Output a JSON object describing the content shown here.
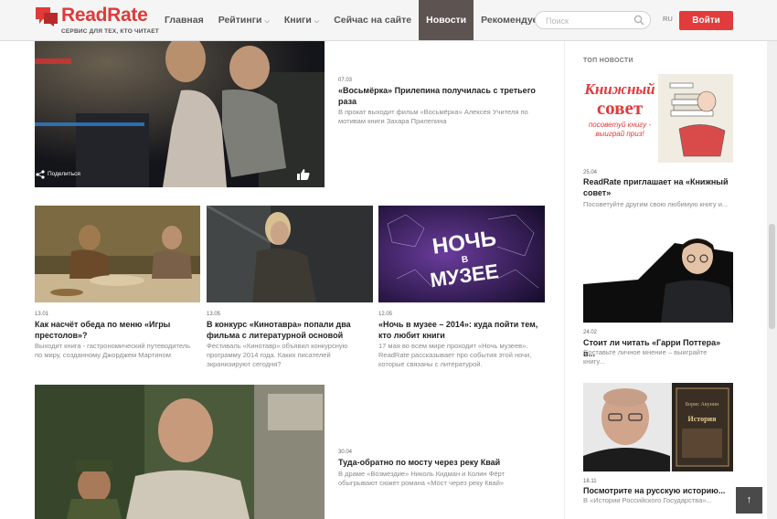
{
  "header": {
    "logo_text": "ReadRate",
    "tagline": "СЕРВИС ДЛЯ ТЕХ, КТО ЧИТАЕТ",
    "nav": [
      {
        "label": "Главная",
        "caret": false,
        "active": false
      },
      {
        "label": "Рейтинги",
        "caret": true,
        "active": false
      },
      {
        "label": "Книги",
        "caret": true,
        "active": false
      },
      {
        "label": "Сейчас на сайте",
        "caret": false,
        "active": false
      },
      {
        "label": "Новости",
        "caret": false,
        "active": true
      },
      {
        "label": "Рекомендуем",
        "caret": false,
        "active": false
      }
    ],
    "search_placeholder": "Поиск",
    "lang": "RU",
    "login_label": "Войти"
  },
  "feature": {
    "date": "07.03",
    "title": "«Восьмёрка» Прилепина получилась с третьего раза",
    "desc": "В прокат выходит фильм «Восьмёрка» Алексея Учителя по мотивам книги Захара Прилепина",
    "share_label": "Поделиться"
  },
  "grid": [
    {
      "date": "13.01",
      "title": "Как насчёт обеда по меню «Игры престолов»?",
      "desc": "Выходит книга - гастрономический путеводитель по миру, созданному Джорджем Мартином"
    },
    {
      "date": "13.05",
      "title": "В конкурс «Кинотавра» попали два фильма с литературной основой",
      "desc": "Фестиваль «Кинотавр» объявил конкурсную программу 2014 года. Каких писателей экранизируют сегодня?"
    },
    {
      "date": "12.05",
      "title": "«Ночь в музее – 2014»: куда пойти тем, кто любит книги",
      "desc": "17 мая во всем мире проходит «Ночь музеев». ReadRate рассказывает про события этой ночи, которые связаны с литературой.",
      "poster_text": [
        "НОЧЬ",
        "В",
        "МУЗЕЕ"
      ]
    }
  ],
  "feature2": {
    "date": "30.04",
    "title": "Туда-обратно по мосту через реку Квай",
    "desc": "В драме «Возмездие» Николь Кидман и Колин Фёрт обыгрывают сюжет романа «Мост через реку Квай»"
  },
  "sidebar": {
    "heading": "ТОП НОВОСТИ",
    "items": [
      {
        "date": "25.04",
        "title": "ReadRate приглашает на «Книжный совет»",
        "desc": "Посоветуйте другим свою любимую книгу и...",
        "promo_title": "Книжный совет",
        "promo_sub": "посоветуй книгу - выиграй приз!"
      },
      {
        "date": "24.02",
        "title": "Стоит ли читать «Гарри Поттера» в...",
        "desc": "Составьте личное мнение – выиграйте книгу..."
      },
      {
        "date": "18.11",
        "title": "Посмотрите на русскую историю...",
        "desc": "В «Истории Российского Государства»...",
        "book_author": "Борис Акунин",
        "book_title": "История"
      }
    ]
  },
  "scroll_top_icon": "arrow-up-icon",
  "colors": {
    "brand": "#e23b3b",
    "nav_active": "#5d5452"
  }
}
